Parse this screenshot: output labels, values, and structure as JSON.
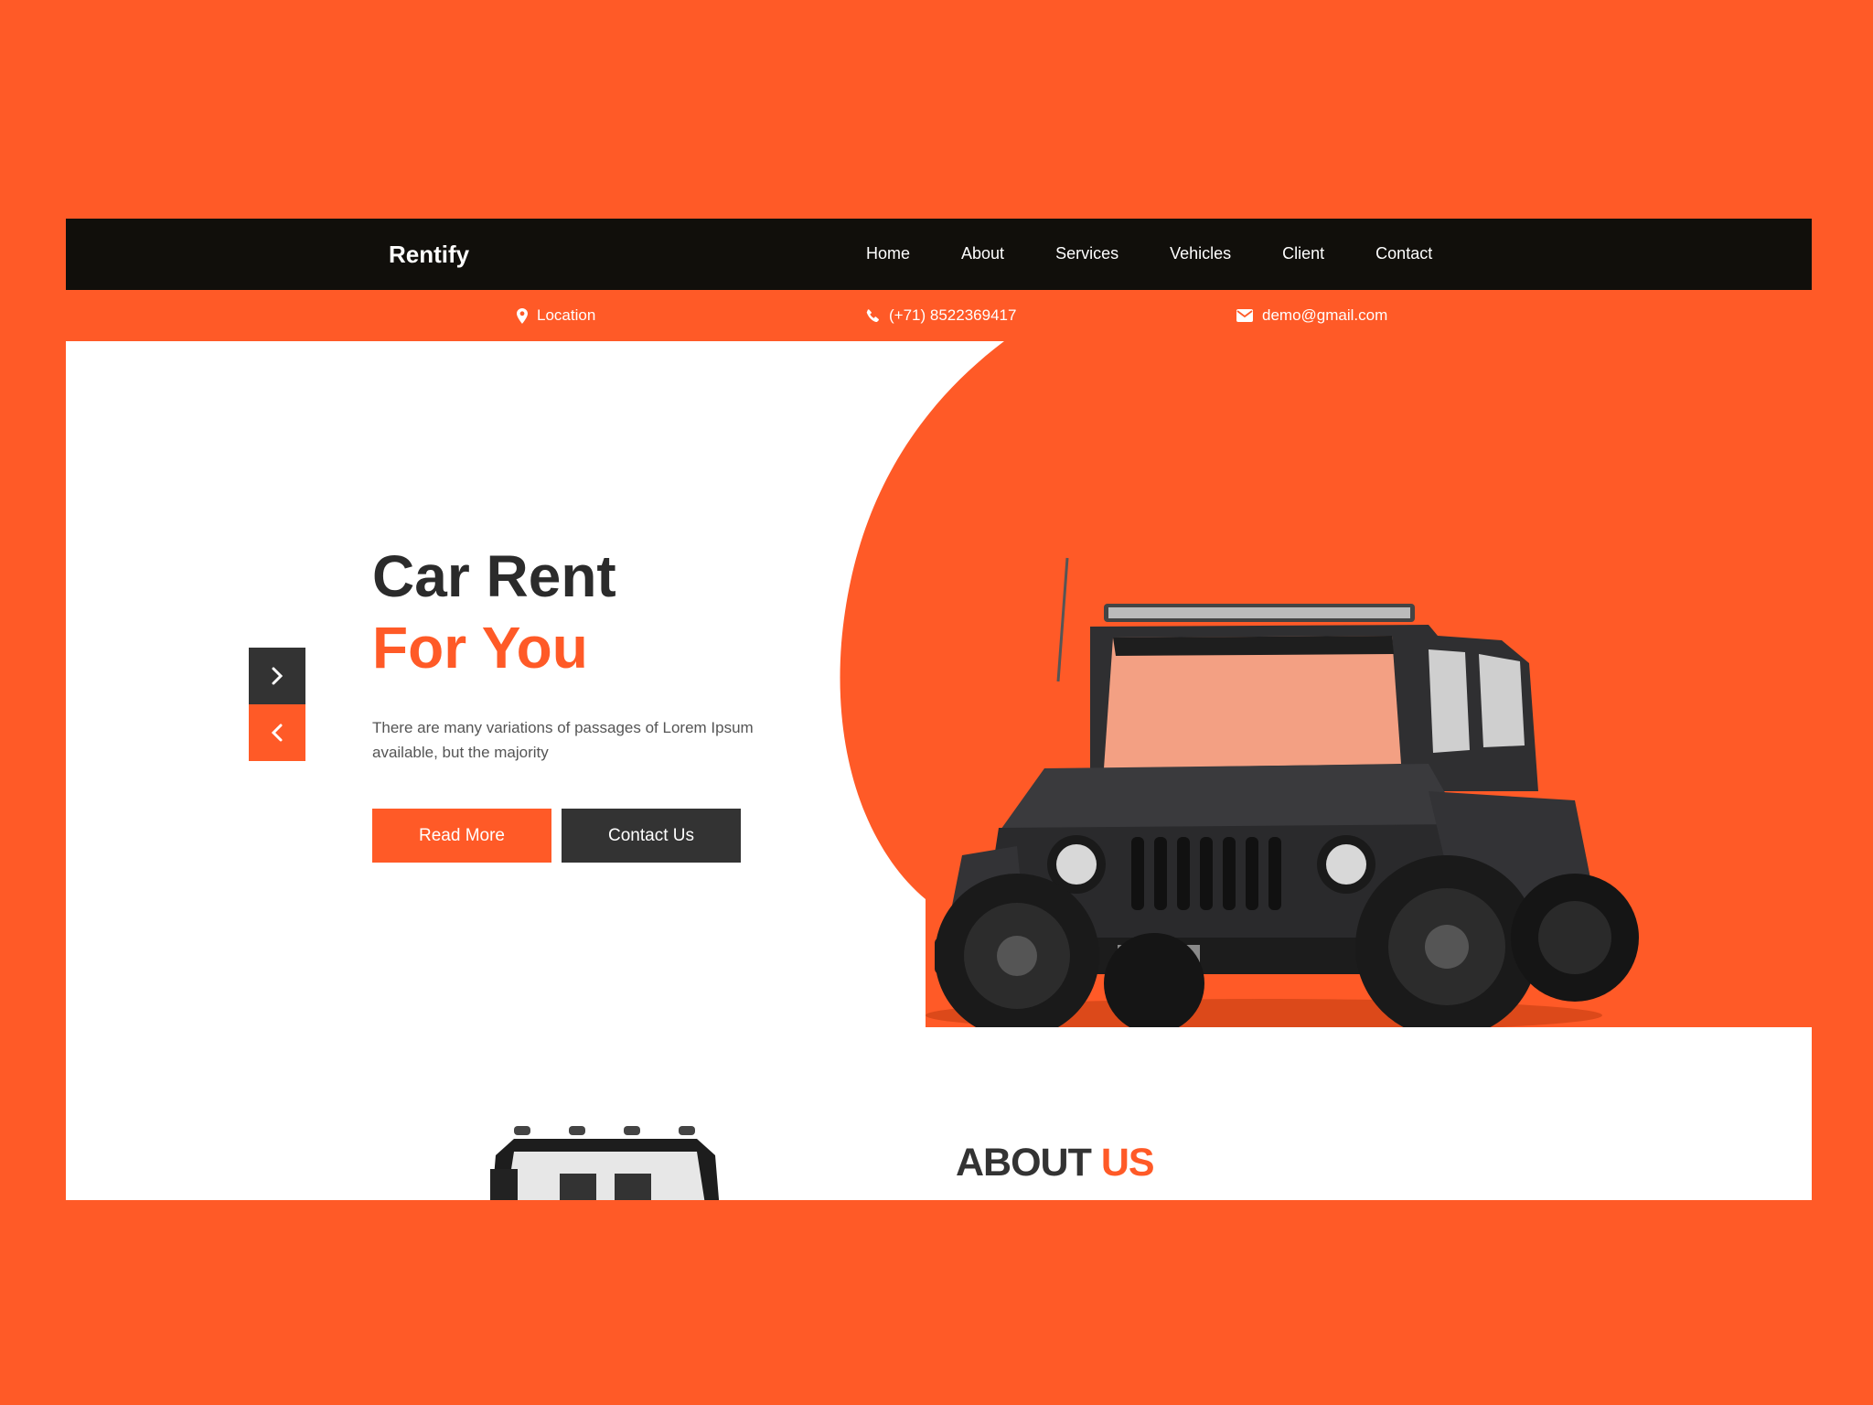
{
  "nav": {
    "brand": "Rentify",
    "items": [
      "Home",
      "About",
      "Services",
      "Vehicles",
      "Client",
      "Contact"
    ]
  },
  "info": {
    "location": "Location",
    "phone": "(+71) 8522369417",
    "email": "demo@gmail.com"
  },
  "hero": {
    "title_line1": "Car Rent",
    "title_line2": "For You",
    "description": "There are many variations of passages of Lorem Ipsum available, but the majority",
    "read_more": "Read More",
    "contact_us": "Contact Us",
    "image_alt": "black off-road jeep"
  },
  "about": {
    "title_main": "ABOUT",
    "title_accent": "US"
  },
  "icons": {
    "location": "location-pin-icon",
    "phone": "phone-icon",
    "email": "envelope-icon",
    "next": "chevron-right-icon",
    "prev": "chevron-left-icon"
  },
  "colors": {
    "accent": "#ff5a27",
    "nav_bg": "#110f0b",
    "dark_button": "#333333",
    "title": "#2b2b2b"
  }
}
